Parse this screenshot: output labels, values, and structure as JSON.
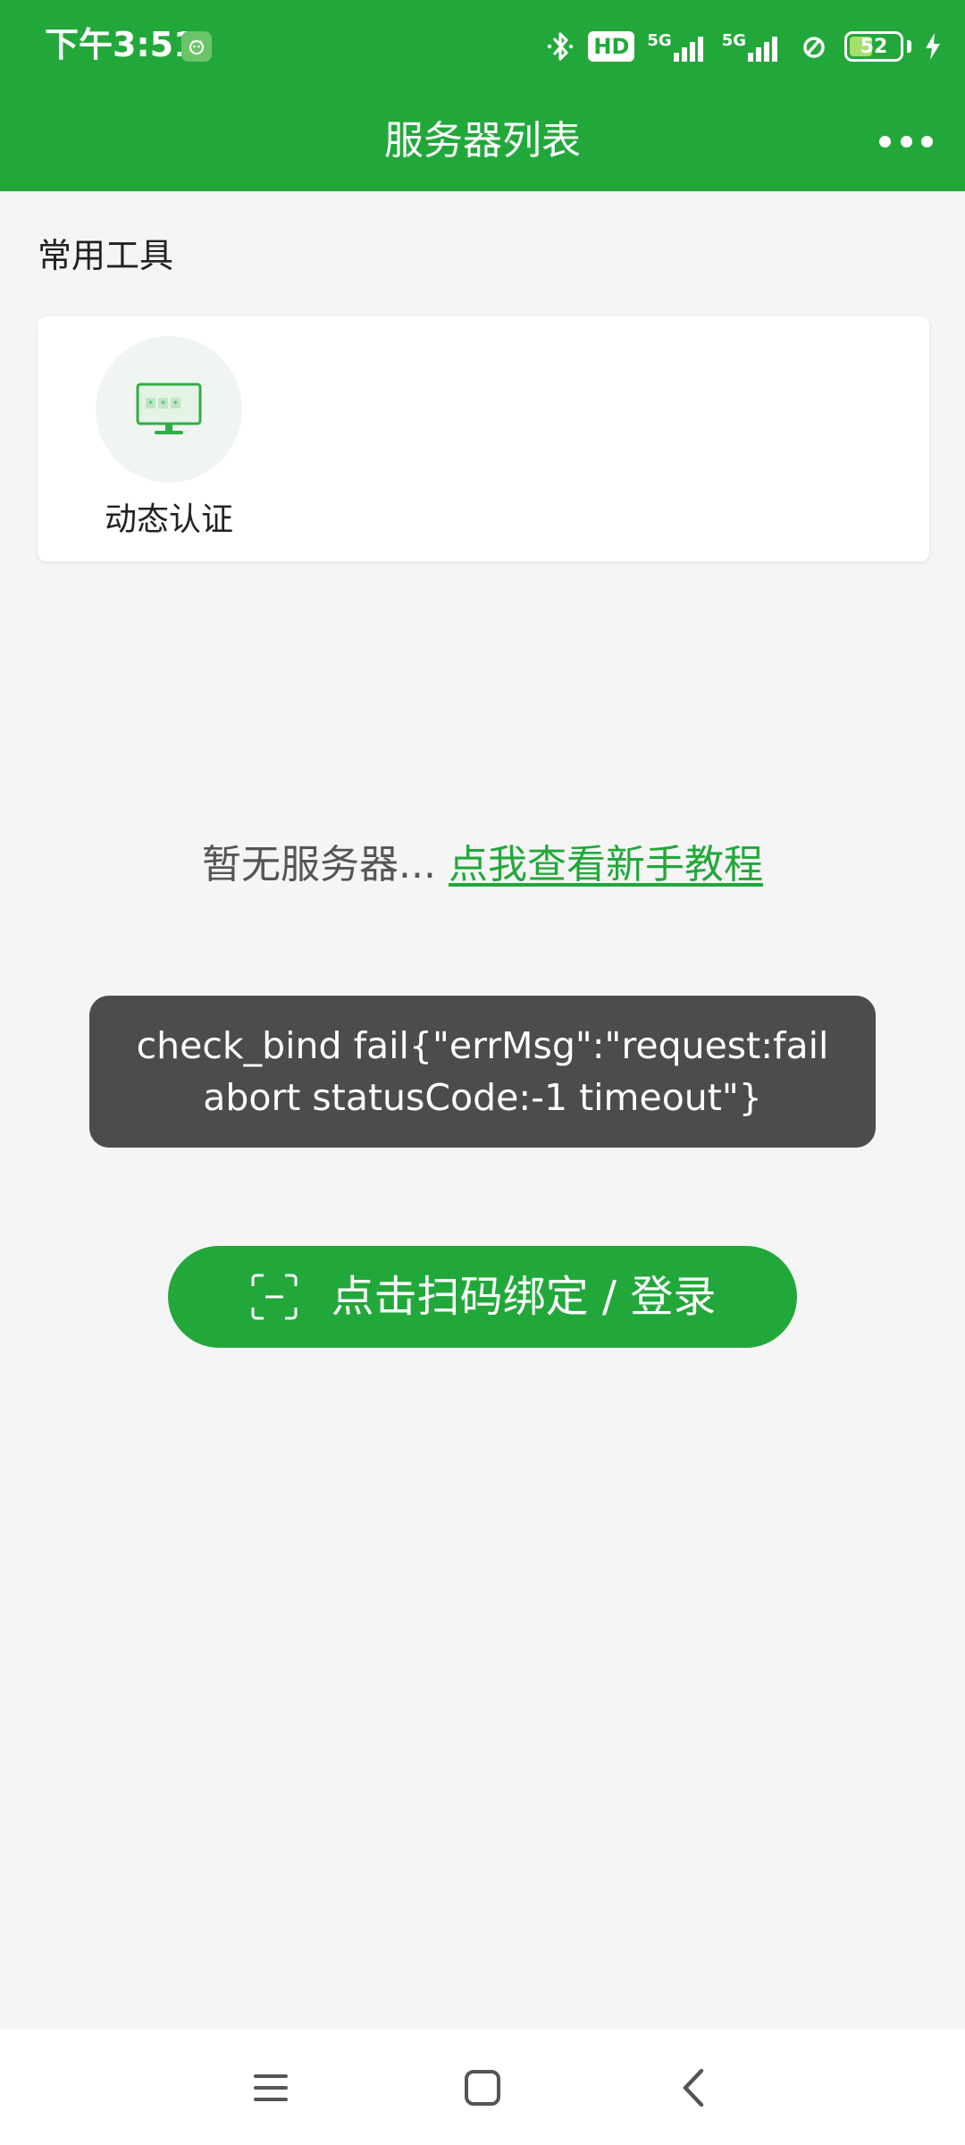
{
  "status_bar": {
    "time": "下午3:51",
    "hd_label": "HD",
    "network_1": "5G",
    "network_2": "5G",
    "battery_level": 52,
    "battery_text": "52"
  },
  "nav": {
    "title": "服务器列表"
  },
  "tools": {
    "section_title": "常用工具",
    "items": [
      {
        "label": "动态认证",
        "icon": "monitor-password-icon"
      }
    ]
  },
  "empty_state": {
    "text": "暂无服务器...",
    "link": "点我查看新手教程"
  },
  "toast": {
    "message": "check_bind fail{\"errMsg\":\"request:fail abort statusCode:-1 timeout\"}"
  },
  "scan_button": {
    "label": "点击扫码绑定 / 登录",
    "icon": "scan-icon"
  },
  "colors": {
    "brand_green": "#22a83a",
    "toast_bg": "#4c4c4c",
    "page_bg": "#f5f5f5"
  }
}
